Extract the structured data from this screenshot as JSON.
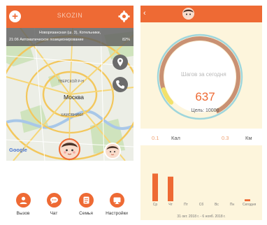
{
  "left": {
    "header": {
      "title": "SKOZIN",
      "add_icon": "plus-icon",
      "settings_icon": "gear-icon"
    },
    "address": {
      "line1": "Новорязанская (ш. 3), Котельники,",
      "line2": "21:06 Автоматическое позиционирование",
      "battery": "82%"
    },
    "map": {
      "city": "Москва",
      "district_north": "ТВЕРСКОЙ Р-Н",
      "district_east": "ХАМОВНИКИ",
      "brand": "Google"
    },
    "nav": [
      {
        "label": "Вызов",
        "icon": "person-icon"
      },
      {
        "label": "Чат",
        "icon": "chat-icon"
      },
      {
        "label": "Семья",
        "icon": "contacts-icon"
      },
      {
        "label": "Настройки",
        "icon": "settings-icon"
      }
    ],
    "colors": {
      "accent": "#ee6a34"
    }
  },
  "right": {
    "header": {
      "back_icon": "back-arrow-icon",
      "avatar_icon": "child-avatar-icon"
    },
    "steps": {
      "label": "Шагов за сегодня",
      "value": "637",
      "goal_text": "Цель: 10000",
      "progress": 0.064
    },
    "stats": {
      "kcal_value": "0.1",
      "kcal_unit": "Кал",
      "km_value": "0.3",
      "km_unit": "Км"
    },
    "chart": {
      "days": [
        "Ср",
        "Чт",
        "Пт",
        "Сб",
        "Вс",
        "Пн",
        "Сегодня"
      ],
      "date_range": "31 окт. 2018 г. - 6 нояб. 2018 г."
    }
  },
  "chart_data": {
    "type": "bar",
    "categories": [
      "Ср",
      "Чт",
      "Пт",
      "Сб",
      "Вс",
      "Пн",
      "Сегодня"
    ],
    "values": [
      9000,
      8000,
      0,
      0,
      0,
      0,
      637
    ],
    "ylim": [
      0,
      10000
    ]
  }
}
